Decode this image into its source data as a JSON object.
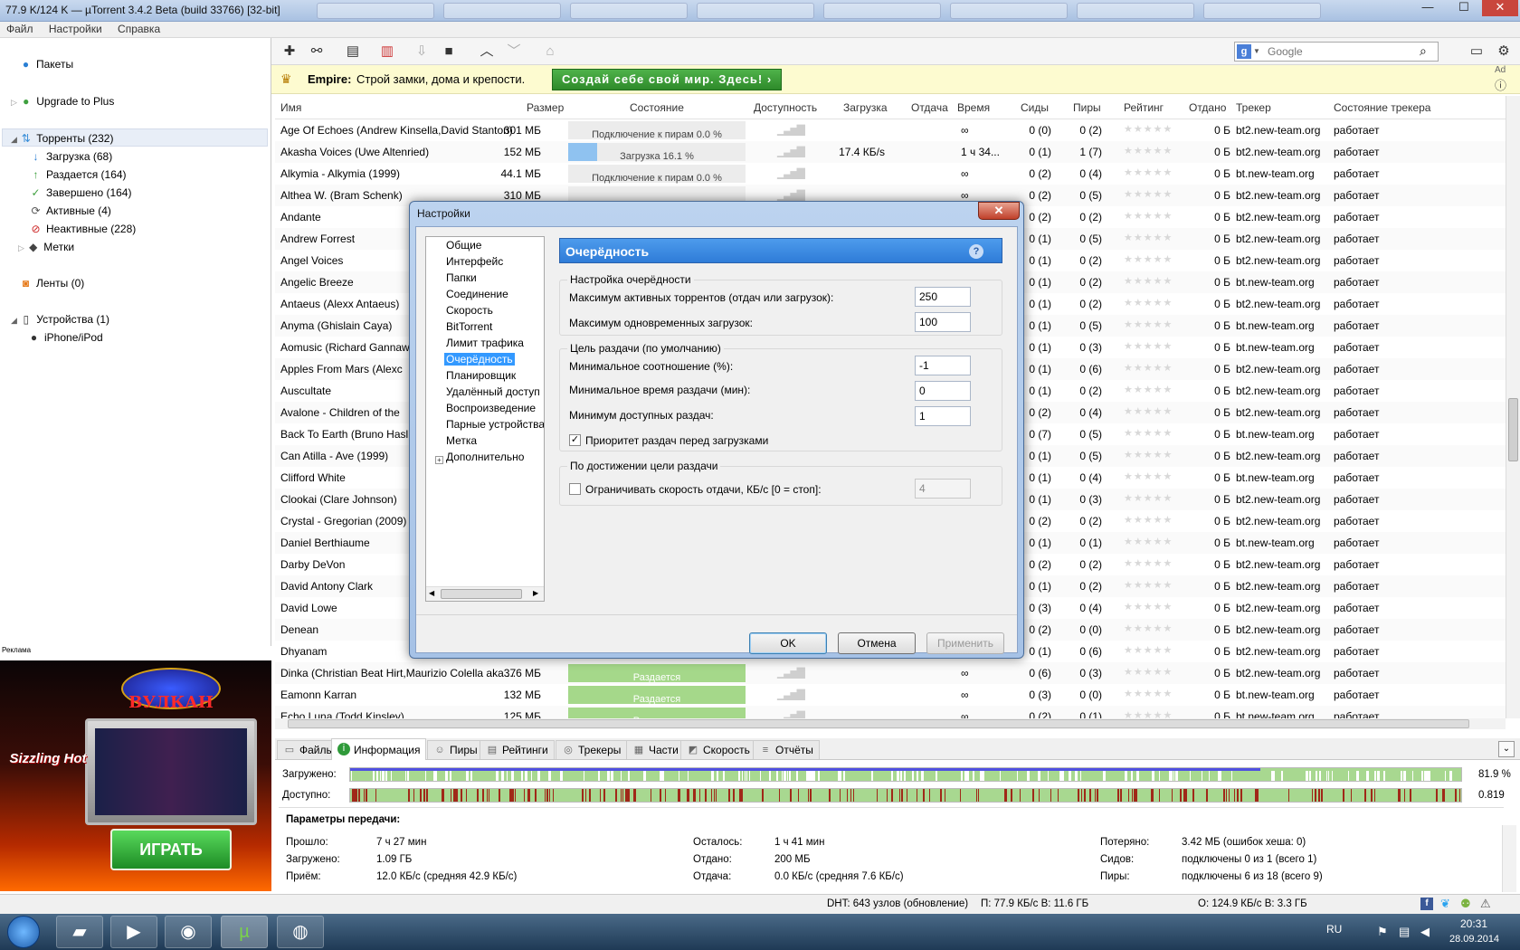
{
  "window": {
    "title": "77.9 K/124 K — µTorrent 3.4.2 Beta (build 33766) [32-bit]",
    "minimize": "—",
    "maximize": "☐",
    "close": "✕"
  },
  "menu": [
    "Файл",
    "Настройки",
    "Справка"
  ],
  "sidebar": {
    "items": [
      {
        "label": "Пакеты",
        "icon": "bundle-icon"
      },
      {
        "label": "Upgrade to Plus",
        "icon": "plus-upgrade-icon"
      },
      {
        "label": "Торренты (232)",
        "icon": "torrents-icon"
      },
      {
        "label": "Загрузка (68)",
        "icon": "download-arrow-icon"
      },
      {
        "label": "Раздается (164)",
        "icon": "upload-arrow-icon"
      },
      {
        "label": "Завершено (164)",
        "icon": "check-icon"
      },
      {
        "label": "Активные (4)",
        "icon": "refresh-icon"
      },
      {
        "label": "Неактивные (228)",
        "icon": "inactive-icon"
      },
      {
        "label": "Метки",
        "icon": "tag-icon"
      },
      {
        "label": "Ленты (0)",
        "icon": "rss-icon"
      },
      {
        "label": "Устройства (1)",
        "icon": "device-icon"
      },
      {
        "label": "iPhone/iPod",
        "icon": "apple-icon"
      }
    ]
  },
  "ad_left": {
    "label": "Реклама",
    "brand": "ВУЛКАН",
    "game": "Sizzling Hot",
    "play_button": "ИГРАТЬ"
  },
  "toolbar": {
    "search_placeholder": "Google",
    "icons": [
      "add-icon",
      "add-link-icon",
      "create-torrent-icon",
      "remove-icon",
      "start-icon",
      "stop-icon",
      "move-up-icon",
      "move-down-icon",
      "unlock-icon"
    ]
  },
  "adbar": {
    "brand": "Empire:",
    "text": "Строй замки, дома и крепости.",
    "cta": "Создай себе свой мир. Здесь! ›",
    "ad_tag": "Ad",
    "info_icon": "ⓘ"
  },
  "table": {
    "columns": [
      "Имя",
      "Размер",
      "Состояние",
      "Доступность",
      "Загрузка",
      "Отдача",
      "Время",
      "Сиды",
      "Пиры",
      "Рейтинг",
      "Отдано",
      "Трекер",
      "Состояние трекера"
    ],
    "rows": [
      {
        "name": "Age Of Echoes (Andrew Kinsella,David Stanton)",
        "size": "301 МБ",
        "state": "Подключение к пирам 0.0 %",
        "progress": 0,
        "kind": "conn",
        "down": "",
        "time": "∞",
        "seeds": "0 (0)",
        "peers": "0 (2)",
        "sent": "0 Б",
        "tracker": "bt2.new-team.org",
        "tstate": "работает"
      },
      {
        "name": "Akasha Voices (Uwe Altenried)",
        "size": "152 МБ",
        "state": "Загрузка 16.1 %",
        "progress": 16.1,
        "kind": "dl",
        "down": "17.4 КБ/s",
        "time": "1 ч 34...",
        "seeds": "0 (1)",
        "peers": "1 (7)",
        "sent": "0 Б",
        "tracker": "bt2.new-team.org",
        "tstate": "работает"
      },
      {
        "name": "Alkymia - Alkymia  (1999)",
        "size": "44.1 МБ",
        "state": "Подключение к пирам 0.0 %",
        "progress": 0,
        "kind": "conn",
        "down": "",
        "time": "∞",
        "seeds": "0 (2)",
        "peers": "0 (4)",
        "sent": "0 Б",
        "tracker": "bt.new-team.org",
        "tstate": "работает"
      },
      {
        "name": "Althea W. (Bram Schenk)",
        "size": "310 МБ",
        "state": "",
        "progress": 0,
        "kind": "conn",
        "down": "",
        "time": "∞",
        "seeds": "0 (2)",
        "peers": "0 (5)",
        "sent": "0 Б",
        "tracker": "bt2.new-team.org",
        "tstate": "работает"
      },
      {
        "name": "Andante",
        "size": "",
        "state": "",
        "progress": 0,
        "kind": "seed",
        "down": "",
        "time": "",
        "seeds": "0 (2)",
        "peers": "0 (2)",
        "sent": "0 Б",
        "tracker": "bt2.new-team.org",
        "tstate": "работает"
      },
      {
        "name": "Andrew Forrest",
        "size": "",
        "state": "",
        "progress": 0,
        "kind": "none",
        "down": "",
        "time": "",
        "seeds": "0 (1)",
        "peers": "0 (5)",
        "sent": "0 Б",
        "tracker": "bt2.new-team.org",
        "tstate": "работает"
      },
      {
        "name": "Angel Voices",
        "size": "",
        "state": "",
        "progress": 0,
        "kind": "none",
        "down": "",
        "time": "",
        "seeds": "0 (1)",
        "peers": "0 (2)",
        "sent": "0 Б",
        "tracker": "bt2.new-team.org",
        "tstate": "работает"
      },
      {
        "name": "Angelic Breeze",
        "size": "",
        "state": "",
        "progress": 0,
        "kind": "none",
        "down": "",
        "time": "",
        "seeds": "0 (1)",
        "peers": "0 (2)",
        "sent": "0 Б",
        "tracker": "bt.new-team.org",
        "tstate": "работает"
      },
      {
        "name": "Antaeus (Alexx Antaeus)",
        "size": "",
        "state": "",
        "progress": 0,
        "kind": "none",
        "down": "",
        "time": "",
        "seeds": "0 (1)",
        "peers": "0 (2)",
        "sent": "0 Б",
        "tracker": "bt2.new-team.org",
        "tstate": "работает"
      },
      {
        "name": "Anyma (Ghislain Caya)",
        "size": "",
        "state": "",
        "progress": 0,
        "kind": "none",
        "down": "",
        "time": "",
        "seeds": "0 (1)",
        "peers": "0 (5)",
        "sent": "0 Б",
        "tracker": "bt.new-team.org",
        "tstate": "работает"
      },
      {
        "name": "Aomusic (Richard Gannaw",
        "size": "",
        "state": "",
        "progress": 0,
        "kind": "none",
        "down": "",
        "time": "",
        "seeds": "0 (1)",
        "peers": "0 (3)",
        "sent": "0 Б",
        "tracker": "bt.new-team.org",
        "tstate": "работает"
      },
      {
        "name": "Apples From Mars (Alexc",
        "size": "",
        "state": "",
        "progress": 0,
        "kind": "none",
        "down": "",
        "time": "",
        "seeds": "0 (1)",
        "peers": "0 (6)",
        "sent": "0 Б",
        "tracker": "bt2.new-team.org",
        "tstate": "работает"
      },
      {
        "name": "Auscultate",
        "size": "",
        "state": "",
        "progress": 0,
        "kind": "none",
        "down": "",
        "time": "",
        "seeds": "0 (1)",
        "peers": "0 (2)",
        "sent": "0 Б",
        "tracker": "bt2.new-team.org",
        "tstate": "работает"
      },
      {
        "name": "Avalone - Children of the",
        "size": "",
        "state": "",
        "progress": 0,
        "kind": "none",
        "down": "",
        "time": "",
        "seeds": "0 (2)",
        "peers": "0 (4)",
        "sent": "0 Б",
        "tracker": "bt2.new-team.org",
        "tstate": "работает"
      },
      {
        "name": "Back To Earth (Bruno Hasl",
        "size": "",
        "state": "",
        "progress": 0,
        "kind": "none",
        "down": "",
        "time": "",
        "seeds": "0 (7)",
        "peers": "0 (5)",
        "sent": "0 Б",
        "tracker": "bt.new-team.org",
        "tstate": "работает"
      },
      {
        "name": "Can Atilla - Ave (1999)",
        "size": "",
        "state": "",
        "progress": 0,
        "kind": "none",
        "down": "",
        "time": "",
        "seeds": "0 (1)",
        "peers": "0 (5)",
        "sent": "0 Б",
        "tracker": "bt2.new-team.org",
        "tstate": "работает"
      },
      {
        "name": "Clifford White",
        "size": "",
        "state": "",
        "progress": 0,
        "kind": "none",
        "down": "",
        "time": "",
        "seeds": "0 (1)",
        "peers": "0 (4)",
        "sent": "0 Б",
        "tracker": "bt.new-team.org",
        "tstate": "работает"
      },
      {
        "name": "Clookai (Clare Johnson)",
        "size": "",
        "state": "",
        "progress": 0,
        "kind": "none",
        "down": "",
        "time": "",
        "seeds": "0 (1)",
        "peers": "0 (3)",
        "sent": "0 Б",
        "tracker": "bt2.new-team.org",
        "tstate": "работает"
      },
      {
        "name": "Crystal - Gregorian  (2009)",
        "size": "",
        "state": "",
        "progress": 0,
        "kind": "none",
        "down": "",
        "time": "",
        "seeds": "0 (2)",
        "peers": "0 (2)",
        "sent": "0 Б",
        "tracker": "bt2.new-team.org",
        "tstate": "работает"
      },
      {
        "name": "Daniel Berthiaume",
        "size": "",
        "state": "",
        "progress": 0,
        "kind": "none",
        "down": "",
        "time": "",
        "seeds": "0 (1)",
        "peers": "0 (1)",
        "sent": "0 Б",
        "tracker": "bt.new-team.org",
        "tstate": "работает"
      },
      {
        "name": "Darby DeVon",
        "size": "",
        "state": "",
        "progress": 0,
        "kind": "none",
        "down": "",
        "time": "",
        "seeds": "0 (2)",
        "peers": "0 (2)",
        "sent": "0 Б",
        "tracker": "bt2.new-team.org",
        "tstate": "работает"
      },
      {
        "name": "David Antony Clark",
        "size": "",
        "state": "",
        "progress": 0,
        "kind": "none",
        "down": "",
        "time": "",
        "seeds": "0 (1)",
        "peers": "0 (2)",
        "sent": "0 Б",
        "tracker": "bt2.new-team.org",
        "tstate": "работает"
      },
      {
        "name": "David Lowe",
        "size": "",
        "state": "",
        "progress": 0,
        "kind": "none",
        "down": "",
        "time": "",
        "seeds": "0 (3)",
        "peers": "0 (4)",
        "sent": "0 Б",
        "tracker": "bt2.new-team.org",
        "tstate": "работает"
      },
      {
        "name": "Denean",
        "size": "",
        "state": "",
        "progress": 0,
        "kind": "none",
        "down": "",
        "time": "",
        "seeds": "0 (2)",
        "peers": "0 (0)",
        "sent": "0 Б",
        "tracker": "bt2.new-team.org",
        "tstate": "работает"
      },
      {
        "name": "Dhyanam",
        "size": "",
        "state": "",
        "progress": 0,
        "kind": "none",
        "down": "",
        "time": "",
        "seeds": "0 (1)",
        "peers": "0 (6)",
        "sent": "0 Б",
        "tracker": "bt2.new-team.org",
        "tstate": "работает"
      },
      {
        "name": "Dinka (Christian Beat Hirt,Maurizio Colella aka ...",
        "size": "376 МБ",
        "state": "Раздается",
        "progress": 100,
        "kind": "seed",
        "down": "",
        "time": "∞",
        "seeds": "0 (6)",
        "peers": "0 (3)",
        "sent": "0 Б",
        "tracker": "bt2.new-team.org",
        "tstate": "работает"
      },
      {
        "name": "Eamonn Karran",
        "size": "132 МБ",
        "state": "Раздается",
        "progress": 100,
        "kind": "seed",
        "down": "",
        "time": "∞",
        "seeds": "0 (3)",
        "peers": "0 (0)",
        "sent": "0 Б",
        "tracker": "bt.new-team.org",
        "tstate": "работает"
      },
      {
        "name": "Echo Luna (Todd Kinsley)",
        "size": "125 МБ",
        "state": "Раздается",
        "progress": 100,
        "kind": "seed",
        "down": "",
        "time": "∞",
        "seeds": "0 (2)",
        "peers": "0 (1)",
        "sent": "0 Б",
        "tracker": "bt.new-team.org",
        "tstate": "работает"
      }
    ]
  },
  "bottom_tabs": [
    {
      "label": "Файлы",
      "icon": "files-icon"
    },
    {
      "label": "Информация",
      "icon": "info-icon"
    },
    {
      "label": "Пиры",
      "icon": "peers-icon"
    },
    {
      "label": "Рейтинги",
      "icon": "ratings-icon"
    },
    {
      "label": "Трекеры",
      "icon": "trackers-icon"
    },
    {
      "label": "Части",
      "icon": "pieces-icon"
    },
    {
      "label": "Скорость",
      "icon": "speed-icon"
    },
    {
      "label": "Отчёты",
      "icon": "logs-icon"
    }
  ],
  "info": {
    "downloaded_label": "Загружено:",
    "downloaded_value": "81.9 %",
    "downloaded_fraction": 0.819,
    "available_label": "Доступно:",
    "available_value": "0.819",
    "section_title": "Параметры передачи:",
    "c1": [
      [
        "Прошло:",
        "7 ч 27 мин"
      ],
      [
        "Загружено:",
        "1.09 ГБ"
      ],
      [
        "Приём:",
        "12.0 КБ/с (средняя 42.9 КБ/с)"
      ]
    ],
    "c2": [
      [
        "Осталось:",
        "1 ч 41 мин"
      ],
      [
        "Отдано:",
        "200 МБ"
      ],
      [
        "Отдача:",
        "0.0 КБ/с (средняя 7.6 КБ/с)"
      ]
    ],
    "c3": [
      [
        "Потеряно:",
        "3.42 МБ (ошибок хеша: 0)"
      ],
      [
        "Сидов:",
        "подключены 0 из 1 (всего 1)"
      ],
      [
        "Пиры:",
        "подключены 6 из 18 (всего 9)"
      ]
    ]
  },
  "status": {
    "dht": "DHT: 643 узлов  (обновление)",
    "down": "П: 77.9 КБ/с В: 11.6 ГБ",
    "up": "О: 124.9 КБ/с В: 3.3 ГБ"
  },
  "taskbar": {
    "lang": "RU",
    "time": "20:31",
    "date": "28.09.2014",
    "apps": [
      "start-orb-icon",
      "explorer-icon",
      "media-player-icon",
      "chrome-icon",
      "utorrent-icon",
      "app-icon"
    ]
  },
  "dialog": {
    "title": "Настройки",
    "close": "✕",
    "tree": [
      "Общие",
      "Интерфейс",
      "Папки",
      "Соединение",
      "Скорость",
      "BitTorrent",
      "Лимит трафика",
      "Очерёдность",
      "Планировщик",
      "Удалённый доступ",
      "Воспроизведение",
      "Парные устройства",
      "Метка",
      "Дополнительно"
    ],
    "selected": "Очерёдность",
    "panel_title": "Очерёдность",
    "help": "?",
    "group1_title": "Настройка очерёдности",
    "max_active_label": "Максимум активных торрентов (отдач или загрузок):",
    "max_active_value": "250",
    "max_dl_label": "Максимум одновременных загрузок:",
    "max_dl_value": "100",
    "group2_title": "Цель раздачи (по умолчанию)",
    "min_ratio_label": "Минимальное соотношение (%):",
    "min_ratio_value": "-1",
    "min_time_label": "Минимальное время раздачи (мин):",
    "min_time_value": "0",
    "min_avail_label": "Минимум доступных раздач:",
    "min_avail_value": "1",
    "priority_label": "Приоритет раздач перед загрузками",
    "priority_checked": "✓",
    "group3_title": "По достижении цели раздачи",
    "limit_label": "Ограничивать скорость отдачи, КБ/с [0 = стоп]:",
    "limit_value": "4",
    "ok": "OK",
    "cancel": "Отмена",
    "apply": "Применить"
  }
}
